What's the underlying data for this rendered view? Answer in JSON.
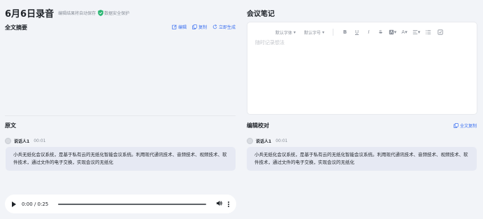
{
  "header": {
    "title": "6月6日录音",
    "subtitle": "编辑结果将自动保存",
    "security": "数据安全保护"
  },
  "summary": {
    "title": "全文摘要",
    "actions": {
      "edit": "编辑",
      "copy": "复制",
      "generate": "立即生成"
    }
  },
  "notes": {
    "title": "会议笔记",
    "toolbar": {
      "font": "默认字体",
      "size": "默认字号"
    },
    "placeholder": "随时记录想法"
  },
  "original": {
    "title": "原文",
    "speaker": "说话人1",
    "time": "00:01",
    "text": "小兵无纸化会议系统，是基于私有云的无纸化智能会议系统。利用现代通讯技术、音频技术、视频技术、软件技术，通过文件的电子交换，实现会议的无纸化"
  },
  "proofread": {
    "title": "编辑校对",
    "copy_all": "全文复制",
    "speaker": "说话人1",
    "time": "00:01",
    "text": "小兵无纸化会议系统，是基于私有云的无纸化智能会议系统。利用现代通讯技术、音频技术、视频技术、软件技术，通过文件的电子交换，实现会议的无纸化"
  },
  "player": {
    "time": "0:00 / 0:25",
    "progress": 0
  },
  "colors": {
    "accent": "#3a6ff0",
    "background": "#f2f4f8",
    "bubble": "#e6e9f3"
  }
}
